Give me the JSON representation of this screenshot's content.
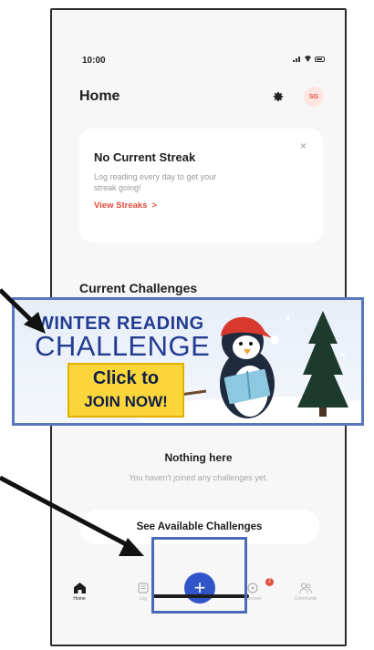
{
  "status": {
    "time": "10:00"
  },
  "header": {
    "title": "Home",
    "avatar_initials": "SG"
  },
  "streak_card": {
    "title": "No Current Streak",
    "text": "Log reading every day to get your streak going!",
    "link": "View Streaks",
    "link_arrow": ">",
    "close": "×"
  },
  "challenges": {
    "title": "Current Challenges",
    "empty_title": "Nothing here",
    "empty_text": "You haven't joined any challenges yet.",
    "button": "See Available Challenges"
  },
  "banner": {
    "line1": "WINTER READING",
    "line2": "CHALLENGE",
    "cta_line1": "Click to",
    "cta_line2": "JOIN NOW!"
  },
  "tabs": [
    {
      "label": "Home",
      "icon": "home-icon"
    },
    {
      "label": "Log",
      "icon": "log-icon"
    },
    {
      "label": "Discover",
      "icon": "discover-icon"
    },
    {
      "label": "Community",
      "icon": "community-icon"
    }
  ],
  "tab_badge": "2",
  "fab": {
    "label": "+"
  },
  "colors": {
    "accent": "#2f55c8",
    "brand_red": "#e2493a",
    "cta_yellow": "#fbd63a",
    "outline_blue": "#4a69b8"
  }
}
